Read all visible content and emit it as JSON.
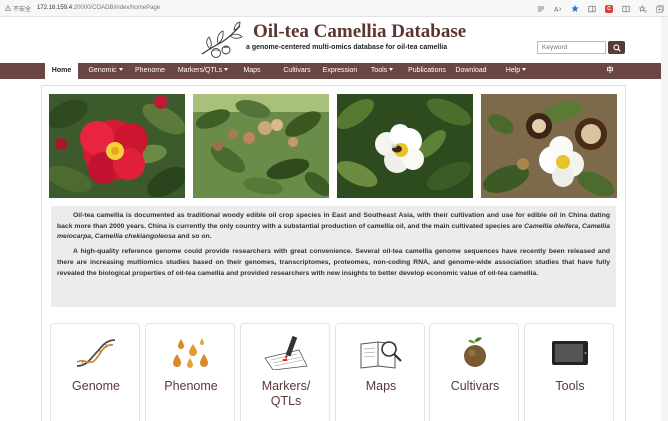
{
  "browser": {
    "security_label": "不安全",
    "url_host": "172.16.159.4",
    "url_path": ":20000/COADB/index/homePage"
  },
  "header": {
    "title": "Oil-tea Camellia Database",
    "subtitle": "a genome-centered multi-omics database for oil-tea camellia",
    "search_placeholder": "Keyword"
  },
  "nav": {
    "items": [
      {
        "label": "Home",
        "active": true,
        "dropdown": false
      },
      {
        "label": "Genomic",
        "dropdown": true
      },
      {
        "label": "Phenome",
        "dropdown": false
      },
      {
        "label": "Markers/QTLs",
        "dropdown": true
      },
      {
        "label": "Maps",
        "dropdown": false
      },
      {
        "label": "Cultivars",
        "dropdown": false
      },
      {
        "label": "Expression",
        "dropdown": false
      },
      {
        "label": "Tools",
        "dropdown": true
      },
      {
        "label": "Publications",
        "dropdown": false
      },
      {
        "label": "Download",
        "dropdown": false
      },
      {
        "label": "Help",
        "dropdown": true
      },
      {
        "label": "中",
        "dropdown": false
      }
    ]
  },
  "intro": {
    "p1_a": "Oil-tea camellia is documented as traditional woody edible oil crop species in East and Southeast Asia, with their cultivation and use for edible oil in China dating back more than 2000 years. China is currently the only country with a substantial production of camellia oil, and the main cultivated species are ",
    "p1_species1": "Camellia oleifera",
    "p1_sep1": ", ",
    "p1_species2": "Camellia meiocarpa",
    "p1_sep2": ", ",
    "p1_species3": "Camellia chekiangoleosa",
    "p1_end": " and so on.",
    "p2": "A high-quality reference genome could provide researchers with great convenience. Several oil-tea camellia genome sequences have recently been released and there are increasing multiomics studies based on their genomes, transcriptomes, proteomes, non-coding RNA, and genome-wide association studies that have fully revealed the biological properties of oil-tea camellia and provided researchers with new insights to better develop economic value of oil-tea camellia."
  },
  "cards": [
    {
      "label": "Genome",
      "icon": "dna-icon"
    },
    {
      "label": "Phenome",
      "icon": "oil-drops-icon"
    },
    {
      "label": "Markers/\nQTLs",
      "icon": "marker-pen-icon"
    },
    {
      "label": "Maps",
      "icon": "book-magnifier-icon"
    },
    {
      "label": "Cultivars",
      "icon": "camellia-fruit-icon"
    },
    {
      "label": "Tools",
      "icon": "tablet-icon"
    }
  ],
  "colors": {
    "brand": "#6a4644",
    "title": "#5c3431",
    "card_text": "#5a3a38"
  }
}
